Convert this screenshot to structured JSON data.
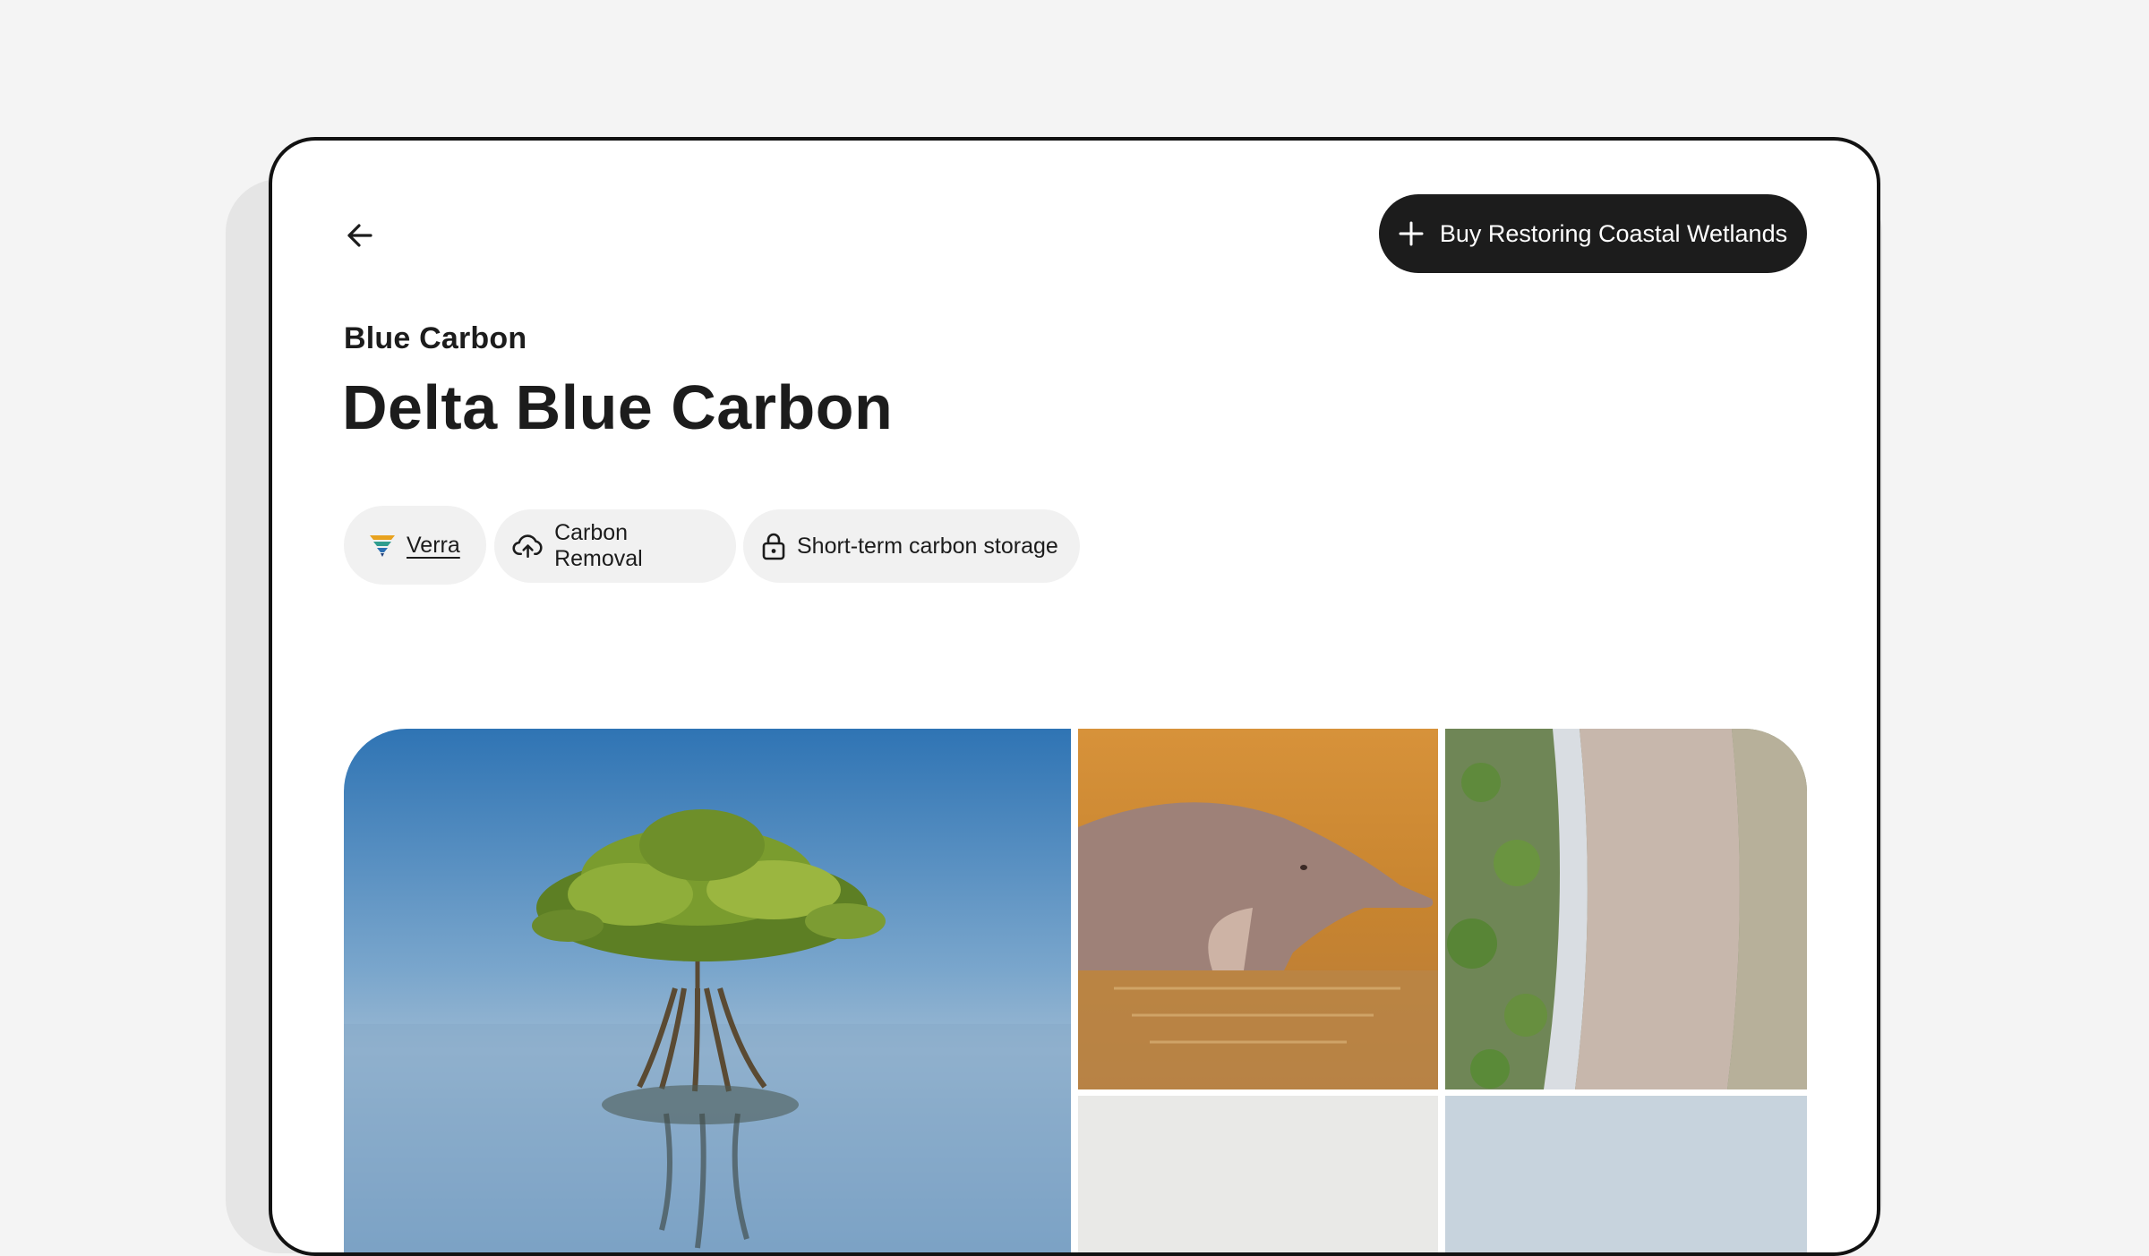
{
  "header": {
    "back_icon": "arrow-left-icon",
    "buy_button_label": "Buy Restoring Coastal Wetlands",
    "buy_button_icon": "plus-icon"
  },
  "project": {
    "category": "Blue Carbon",
    "title": "Delta Blue Carbon"
  },
  "tags": [
    {
      "label": "Verra",
      "icon": "verra-logo-icon",
      "link": true
    },
    {
      "label": "Carbon Removal",
      "icon": "cloud-upload-icon"
    },
    {
      "label": "Short-term carbon storage",
      "icon": "lock-icon"
    }
  ],
  "gallery": {
    "images": [
      "mangrove-tree-photo",
      "river-dolphin-photo",
      "aerial-beach-photo",
      "gallery-photo-4",
      "gallery-photo-5"
    ]
  },
  "colors": {
    "page_background": "#f4f4f4",
    "button_dark": "#1c1c1c",
    "tag_background": "#f1f1f1"
  }
}
